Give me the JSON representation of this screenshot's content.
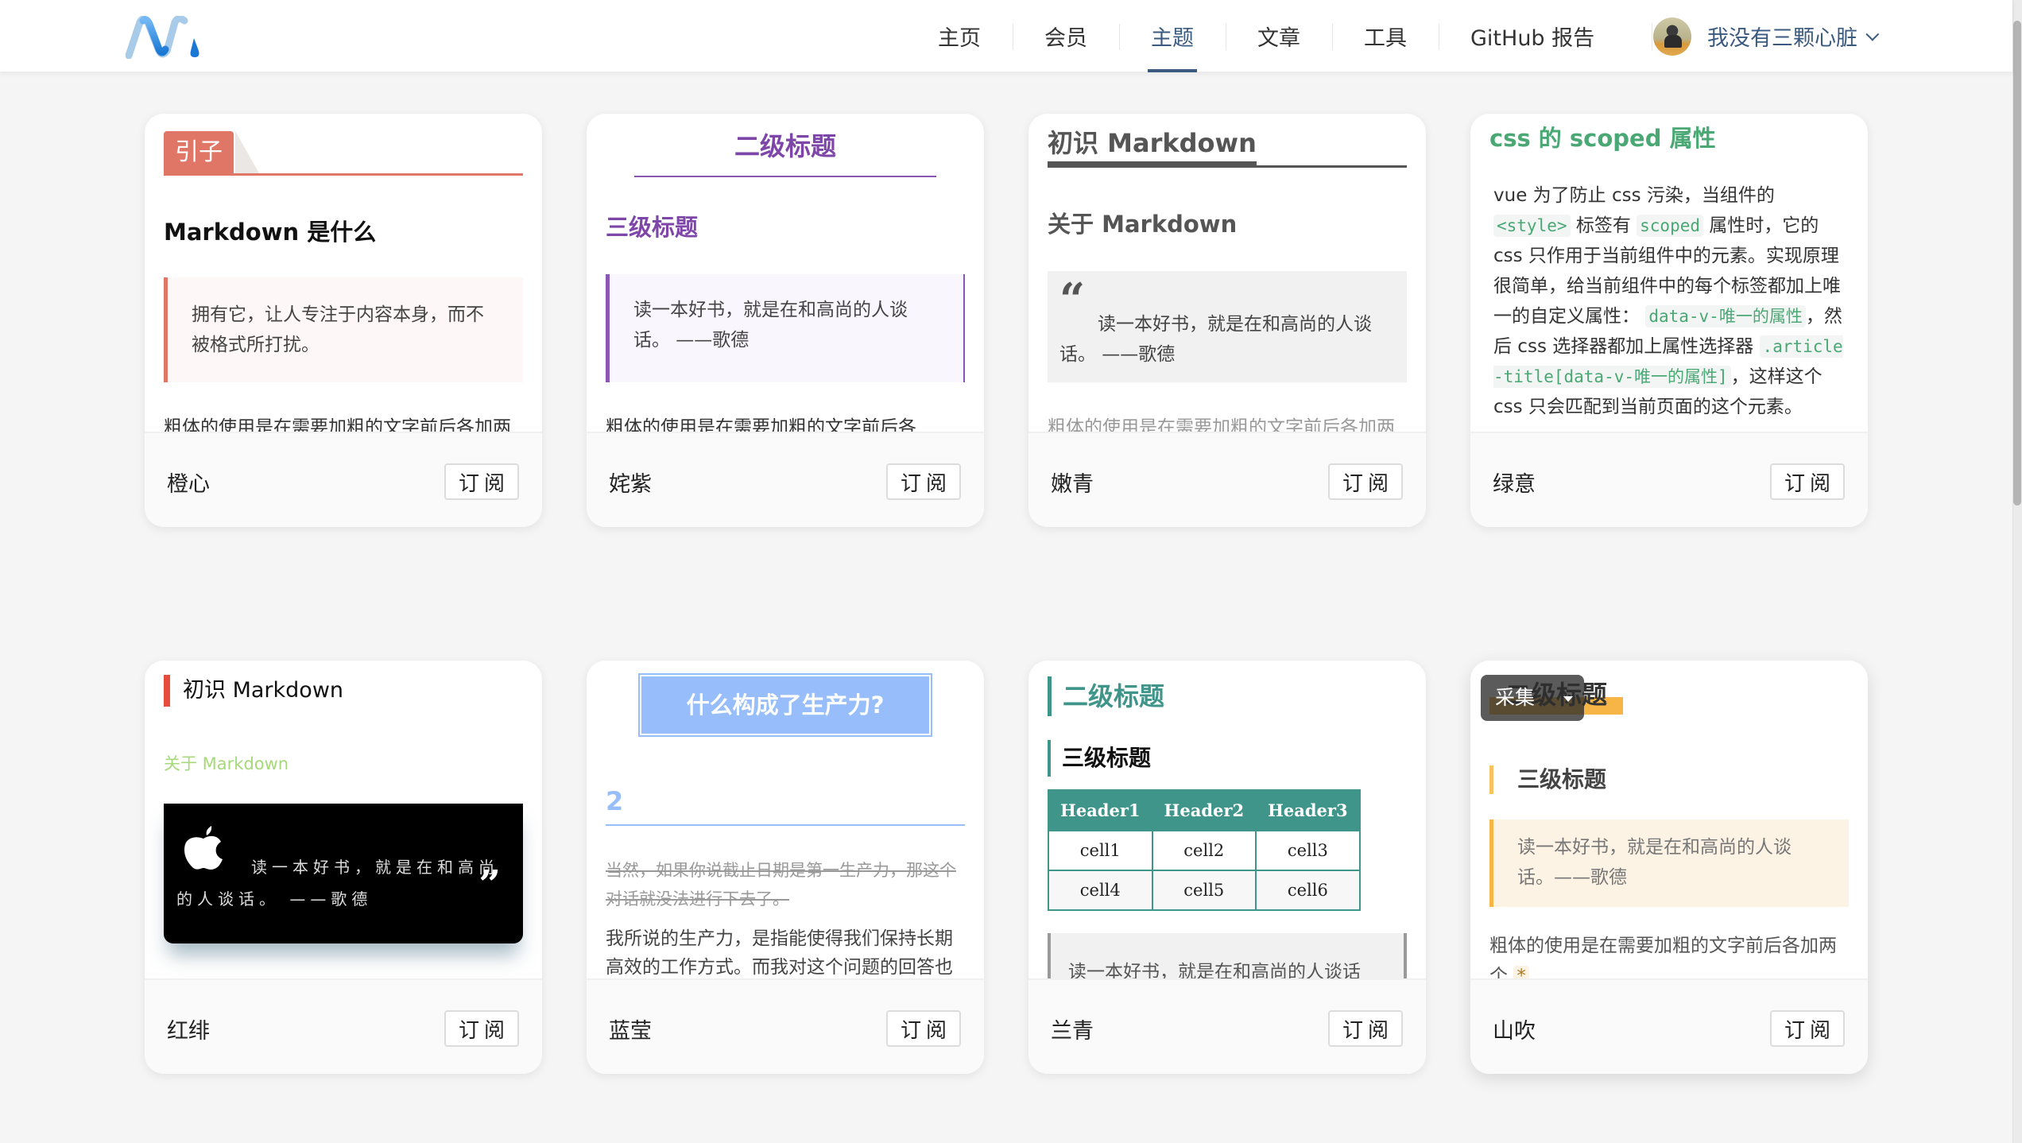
{
  "header": {
    "logo": "N-logo",
    "nav": [
      {
        "label": "主页",
        "active": false
      },
      {
        "label": "会员",
        "active": false
      },
      {
        "label": "主题",
        "active": true
      },
      {
        "label": "文章",
        "active": false
      },
      {
        "label": "工具",
        "active": false
      },
      {
        "label": "GitHub 报告",
        "active": false
      }
    ],
    "user": {
      "name": "我没有三颗心脏",
      "avatar_icon": "user-avatar",
      "dropdown_icon": "chevron-down-icon"
    }
  },
  "colors": {
    "nav_active": "#3b5a7f",
    "chengxin": "#e07666",
    "chazi": "#8a56b5",
    "nenqing": "#555555",
    "lvyi": "#4aa874",
    "hongfei": "#e64b3c",
    "lanying": "#97befa",
    "lanqing": "#40958a",
    "shanchui": "#f6b544"
  },
  "subscribe_label": "订阅",
  "cards": [
    {
      "theme": "橙心",
      "tag": "引子",
      "h2": "Markdown 是什么",
      "quote": "拥有它，让人专注于内容本身，而不被格式所打扰。",
      "para": "粗体的使用是在需要加粗的文字前后各加两"
    },
    {
      "theme": "姹紫",
      "h2": "二级标题",
      "h3": "三级标题",
      "quote": "读一本好书，就是在和高尚的人谈话。 ——歌德",
      "para": "粗体的使用是在需要加粗的文字前后各"
    },
    {
      "theme": "嫩青",
      "h1": "初识 Markdown",
      "h2": "关于 Markdown",
      "quote_mark": "“",
      "quote": "读一本好书，就是在和高尚的人谈话。 ——歌德",
      "para": "粗体的使用是在需要加粗的文字前后各加两"
    },
    {
      "theme": "绿意",
      "h": "css 的 scoped 属性",
      "segments": [
        {
          "t": "vue 为了防止 css 污染，当组件的 "
        },
        {
          "code": "<style>"
        },
        {
          "t": " 标签有 "
        },
        {
          "code": "scoped"
        },
        {
          "t": " 属性时，它的 css 只作用于当前组件中的元素。实现原理很简单，给当前组件中的每个标签都加上唯一的自定义属性： "
        },
        {
          "code": "data-v-唯一的属性"
        },
        {
          "t": "，然后 css 选择器都加上属性选择器 "
        },
        {
          "code": ".article-title[data-v-唯一的属性]"
        },
        {
          "t": "，这样这个 css 只会匹配到当前页面的这个元素。"
        }
      ]
    },
    {
      "theme": "红绯",
      "h1": "初识 Markdown",
      "h2": "关于 Markdown",
      "quote": "读一本好书，就是在和高尚的人谈话。 ——歌德",
      "close_mark": "”"
    },
    {
      "theme": "蓝莹",
      "h1": "什么构成了生产力?",
      "h2": "2",
      "del": "当然，如果你说截止日期是第一生产力，那这个对话就没法进行下去了。",
      "para": "我所说的生产力，是指能使得我们保持长期高效的工作方式。而我对这个问题的回答也很简"
    },
    {
      "theme": "兰青",
      "h2": "二级标题",
      "h3": "三级标题",
      "table": {
        "headers": [
          "Header1",
          "Header2",
          "Header3"
        ],
        "rows": [
          [
            "cell1",
            "cell2",
            "cell3"
          ],
          [
            "cell4",
            "cell5",
            "cell6"
          ]
        ]
      },
      "quote": "读一本好书，就是在和高尚的人谈话"
    },
    {
      "theme": "山吹",
      "h2": "二级标题",
      "collect_label": "采集",
      "h3": "三级标题",
      "quote": "读一本好书，就是在和高尚的人谈话。——歌德",
      "para": "粗体的使用是在需要加粗的文字前后各加两个",
      "star": "*"
    }
  ]
}
